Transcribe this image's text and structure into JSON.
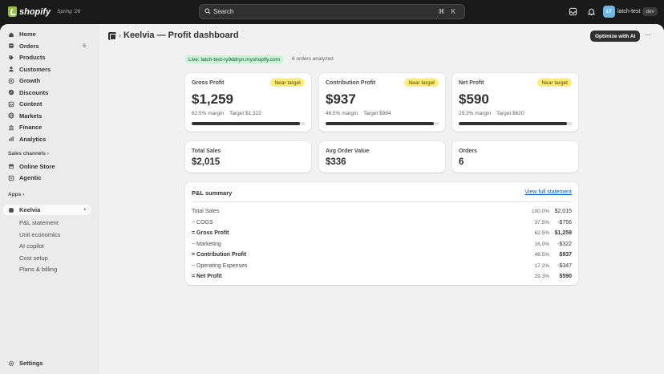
{
  "topbar": {
    "brand": "shopify",
    "edition": "Spring '26",
    "search_placeholder": "Search",
    "search_shortcut": "⌘ K",
    "store_initials": "LT",
    "store_name": "latch-test",
    "store_tag": "dev"
  },
  "sidebar": {
    "nav": [
      {
        "label": "Home",
        "icon": "home-icon"
      },
      {
        "label": "Orders",
        "icon": "orders-icon",
        "badge": "6"
      },
      {
        "label": "Products",
        "icon": "tag-icon"
      },
      {
        "label": "Customers",
        "icon": "person-icon"
      },
      {
        "label": "Growth",
        "icon": "target-icon"
      },
      {
        "label": "Discounts",
        "icon": "discount-icon"
      },
      {
        "label": "Content",
        "icon": "content-icon"
      },
      {
        "label": "Markets",
        "icon": "globe-icon"
      },
      {
        "label": "Finance",
        "icon": "bank-icon"
      },
      {
        "label": "Analytics",
        "icon": "chart-icon"
      }
    ],
    "sales_channels_label": "Sales channels",
    "channels": [
      {
        "label": "Online Store",
        "icon": "store-icon"
      },
      {
        "label": "Agentic",
        "icon": "sparkle-icon"
      }
    ],
    "apps_label": "Apps",
    "app": {
      "label": "Keelvia",
      "icon": "app-icon"
    },
    "app_subnav": [
      "P&L statement",
      "Unit economics",
      "AI copilot",
      "Cost setup",
      "Plans & billing"
    ],
    "settings_label": "Settings"
  },
  "page": {
    "title": "Keelvia — Profit dashboard",
    "primary_action": "Optimize with AI",
    "more_label": "···",
    "live_badge": "Live: latch-test-ry9ddryn.myshopify.com",
    "orders_analyzed": "6 orders analyzed"
  },
  "metrics": [
    {
      "label": "Gross Profit",
      "status": "Near target",
      "value": "$1,259",
      "margin": "62.5% margin",
      "target": "Target $1,322",
      "progress": 0.95
    },
    {
      "label": "Contribution Profit",
      "status": "Near target",
      "value": "$937",
      "margin": "46.5% margin",
      "target": "Target $984",
      "progress": 0.95
    },
    {
      "label": "Net Profit",
      "status": "Near target",
      "value": "$590",
      "margin": "29.3% margin",
      "target": "Target $620",
      "progress": 0.95
    }
  ],
  "stats": [
    {
      "label": "Total Sales",
      "value": "$2,015"
    },
    {
      "label": "Avg Order Value",
      "value": "$336"
    },
    {
      "label": "Orders",
      "value": "6"
    }
  ],
  "pl_summary": {
    "title": "P&L summary",
    "link": "View full statement",
    "rows": [
      {
        "label": "Total Sales",
        "pct": "100.0%",
        "amount": "$2,015",
        "strong": false
      },
      {
        "label": "− COGS",
        "pct": "37.5%",
        "amount": "-$756",
        "strong": false
      },
      {
        "label": "= Gross Profit",
        "pct": "62.5%",
        "amount": "$1,259",
        "strong": true
      },
      {
        "label": "− Marketing",
        "pct": "16.0%",
        "amount": "-$322",
        "strong": false
      },
      {
        "label": "= Contribution Profit",
        "pct": "46.5%",
        "amount": "$937",
        "strong": true
      },
      {
        "label": "− Operating Expenses",
        "pct": "17.2%",
        "amount": "-$347",
        "strong": false
      },
      {
        "label": "= Net Profit",
        "pct": "29.3%",
        "amount": "$590",
        "strong": true
      }
    ]
  },
  "colors": {
    "topbar": "#1a1a1a",
    "brand_green": "#95bf47",
    "pill_yellow": "#ffeb78",
    "live_green": "#c9f4d3",
    "link_blue": "#005bd3"
  }
}
